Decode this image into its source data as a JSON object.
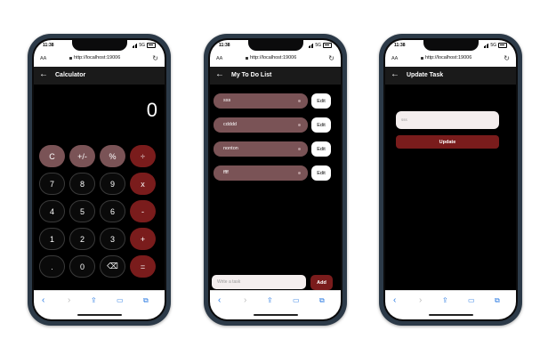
{
  "status": {
    "time": "11:38",
    "network": "5G"
  },
  "browser": {
    "aa_label": "AA",
    "url": "http://localhost:19006"
  },
  "calculator": {
    "title": "Calculator",
    "display": "0",
    "keys": [
      [
        "C",
        "+/-",
        "%",
        "÷"
      ],
      [
        "7",
        "8",
        "9",
        "x"
      ],
      [
        "4",
        "5",
        "6",
        "-"
      ],
      [
        "1",
        "2",
        "3",
        "+"
      ],
      [
        ".",
        "0",
        "⌫",
        "="
      ]
    ]
  },
  "todo": {
    "title": "My To Do List",
    "tasks": [
      "sss",
      "cdddd",
      "nonton",
      "ffff"
    ],
    "edit_label": "Edit",
    "input_placeholder": "Write a task",
    "add_label": "Add"
  },
  "update": {
    "title": "Update Task",
    "input_value": "sss",
    "button_label": "Update"
  },
  "colors": {
    "dark_red": "#7a1c1c",
    "mauve": "#7a5356",
    "background": "#000000"
  }
}
